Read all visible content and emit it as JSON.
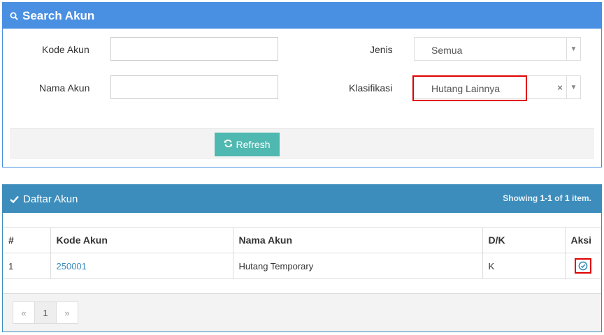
{
  "search_panel": {
    "title": "Search Akun",
    "kode_akun_label": "Kode Akun",
    "kode_akun_value": "",
    "nama_akun_label": "Nama Akun",
    "nama_akun_value": "",
    "jenis_label": "Jenis",
    "jenis_value": "Semua",
    "klasifikasi_label": "Klasifikasi",
    "klasifikasi_value": "Hutang Lainnya",
    "clear_symbol": "×",
    "arrow_symbol": "▼",
    "refresh_label": "Refresh"
  },
  "list_panel": {
    "title": "Daftar Akun",
    "showing_prefix": "Showing",
    "showing_range": "1-1",
    "showing_of": "of",
    "showing_total": "1",
    "showing_suffix": "item.",
    "columns": [
      "#",
      "Kode Akun",
      "Nama Akun",
      "D/K",
      "Aksi"
    ],
    "rows": [
      {
        "no": "1",
        "kode": "250001",
        "nama": "Hutang Temporary",
        "dk": "K"
      }
    ],
    "pagination": {
      "prev": "«",
      "current": "1",
      "next": "»"
    }
  },
  "colors": {
    "search_header": "#4a90e2",
    "list_header": "#3c8dbc",
    "refresh_button": "#4fb8b0",
    "highlight": "#e00000"
  },
  "icons": {
    "search_title": "search-icon",
    "list_title": "check-icon",
    "refresh": "refresh-icon",
    "action": "check-circle-icon"
  }
}
